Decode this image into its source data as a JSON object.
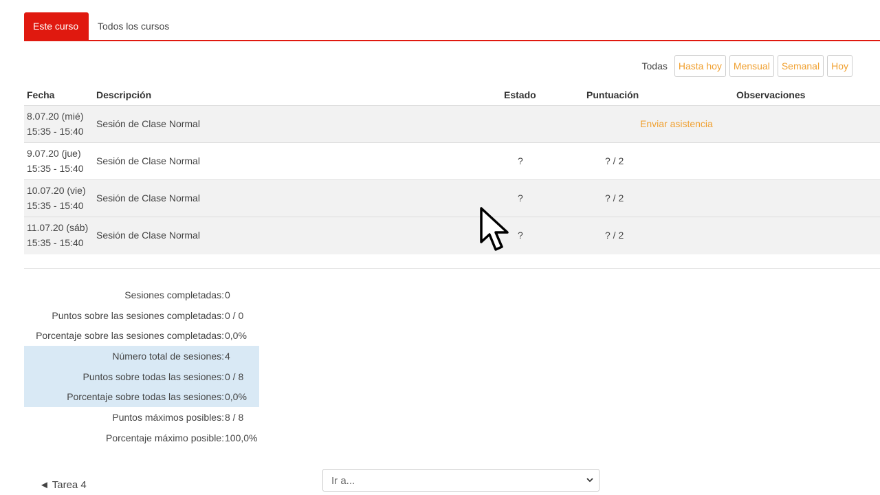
{
  "tabs": {
    "this_course": "Este curso",
    "all_courses": "Todos los cursos"
  },
  "filters": {
    "label": "Todas",
    "buttons": [
      "Hasta hoy",
      "Mensual",
      "Semanal",
      "Hoy"
    ]
  },
  "table": {
    "headers": {
      "fecha": "Fecha",
      "descripcion": "Descripción",
      "estado": "Estado",
      "puntuacion": "Puntuación",
      "observaciones": "Observaciones"
    },
    "rows": [
      {
        "date": "8.07.20 (mié)",
        "time": "15:35 - 15:40",
        "description": "Sesión de Clase Normal",
        "action": "Enviar asistencia"
      },
      {
        "date": "9.07.20 (jue)",
        "time": "15:35 - 15:40",
        "description": "Sesión de Clase Normal",
        "estado": "?",
        "puntuacion": "? / 2"
      },
      {
        "date": "10.07.20 (vie)",
        "time": "15:35 - 15:40",
        "description": "Sesión de Clase Normal",
        "estado": "?",
        "puntuacion": "? / 2"
      },
      {
        "date": "11.07.20 (sáb)",
        "time": "15:35 - 15:40",
        "description": "Sesión de Clase Normal",
        "estado": "?",
        "puntuacion": "? / 2"
      }
    ]
  },
  "summary": [
    {
      "label": "Sesiones completadas:",
      "value": "0"
    },
    {
      "label": "Puntos sobre las sesiones completadas:",
      "value": "0 / 0"
    },
    {
      "label": "Porcentaje sobre las sesiones completadas:",
      "value": "0,0%"
    },
    {
      "label": "Número total de sesiones:",
      "value": "4"
    },
    {
      "label": "Puntos sobre todas las sesiones:",
      "value": "0 / 8"
    },
    {
      "label": "Porcentaje sobre todas las sesiones:",
      "value": "0,0%"
    },
    {
      "label": "Puntos máximos posibles:",
      "value": "8 / 8"
    },
    {
      "label": "Porcentaje máximo posible:",
      "value": "100,0%"
    }
  ],
  "nav": {
    "previous": "◄ Tarea 4",
    "goto_placeholder": "Ir a..."
  },
  "colors": {
    "accent": "#e0190f",
    "link": "#f0a030",
    "highlight": "#d9e9f5"
  },
  "icons": {
    "cursor": "mouse-pointer-icon",
    "chevron": "chevron-down-icon"
  }
}
